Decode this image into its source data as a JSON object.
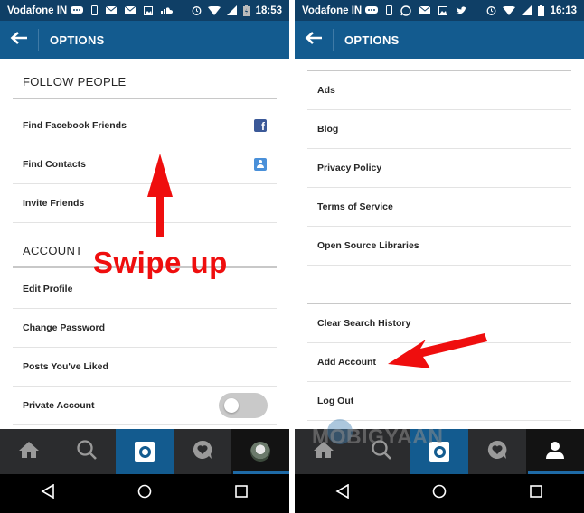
{
  "screens": [
    {
      "status_bar": {
        "carrier": "Vodafone IN",
        "time": "18:53",
        "notification_icons": [
          "chat-icon",
          "phone-icon",
          "mail-icon",
          "mail-icon",
          "image-icon",
          "soundcloud-icon"
        ],
        "system_icons": [
          "alarm-icon",
          "wifi-icon",
          "signal-icon",
          "battery-charging-icon"
        ]
      },
      "app_bar": {
        "back_icon": "arrow-left-icon",
        "title": "OPTIONS"
      },
      "sections": [
        {
          "header": "FOLLOW PEOPLE",
          "items": [
            {
              "label": "Find Facebook Friends",
              "icon": "facebook-icon"
            },
            {
              "label": "Find Contacts",
              "icon": "contact-icon"
            },
            {
              "label": "Invite Friends"
            }
          ]
        },
        {
          "header": "ACCOUNT",
          "items": [
            {
              "label": "Edit Profile"
            },
            {
              "label": "Change Password"
            },
            {
              "label": "Posts You've Liked"
            },
            {
              "label": "Private Account",
              "toggle": "off"
            }
          ]
        }
      ],
      "annotation": "Swipe up"
    },
    {
      "status_bar": {
        "carrier": "Vodafone IN",
        "time": "16:13",
        "notification_icons": [
          "chat-icon",
          "phone-icon",
          "whatsapp-icon",
          "mail-icon",
          "image-icon",
          "twitter-icon"
        ],
        "system_icons": [
          "alarm-icon",
          "wifi-icon",
          "signal-icon",
          "battery-icon"
        ]
      },
      "app_bar": {
        "back_icon": "arrow-left-icon",
        "title": "OPTIONS"
      },
      "about_items": [
        "Ads",
        "Blog",
        "Privacy Policy",
        "Terms of Service",
        "Open Source Libraries"
      ],
      "account_items": [
        "Clear Search History",
        "Add Account",
        "Log Out"
      ],
      "watermark": "MOBIGYAAN"
    }
  ],
  "tab_bar": {
    "tabs": [
      "home",
      "search",
      "camera",
      "activity",
      "profile"
    ]
  },
  "colors": {
    "status_bar": "#0f3f66",
    "app_bar": "#135b8f",
    "annotation": "#ef0e0e"
  }
}
